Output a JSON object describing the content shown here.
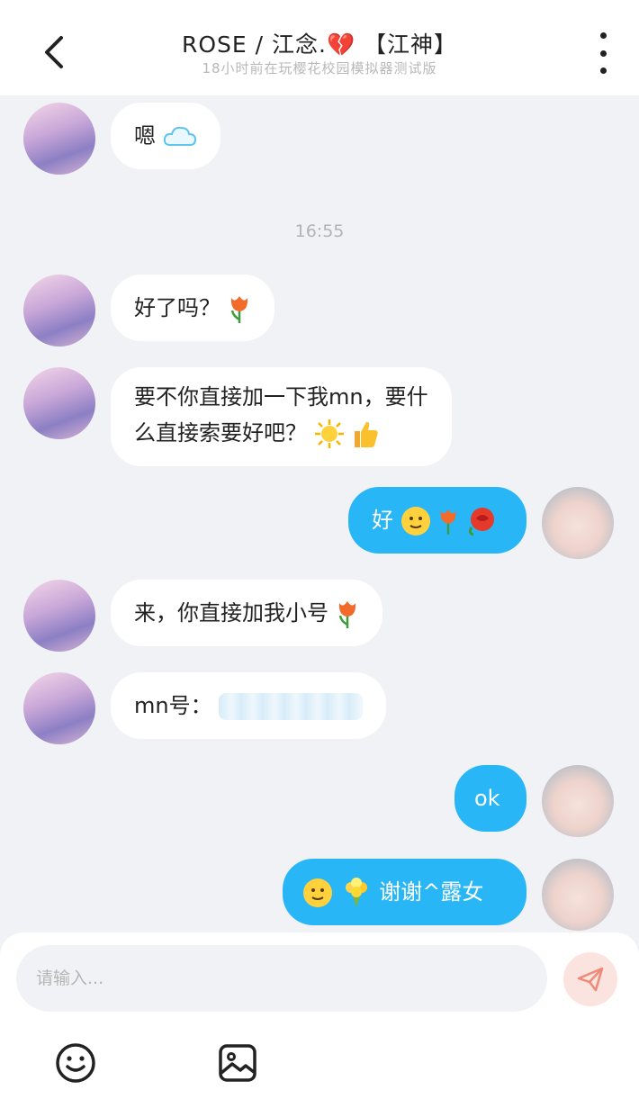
{
  "header": {
    "title": "ROSE / 江念.💔 【江神】",
    "subtitle": "18小时前在玩樱花校园模拟器测试版"
  },
  "chat": {
    "timestamp": "16:55",
    "messages": [
      {
        "side": "left",
        "text": "嗯"
      },
      {
        "side": "left",
        "text": "好了吗？"
      },
      {
        "side": "left",
        "line1": "要不你直接加一下我mn，要什",
        "line2": "么直接索要好吧？"
      },
      {
        "side": "right",
        "text": "好"
      },
      {
        "side": "left",
        "text": "来，你直接加我小号"
      },
      {
        "side": "left",
        "text": "mn号："
      },
      {
        "side": "right",
        "text": "ok"
      },
      {
        "side": "right",
        "text": "谢谢^露女"
      }
    ]
  },
  "composer": {
    "placeholder": "请输入..."
  },
  "colors": {
    "accent": "#29b6f6",
    "send_bg": "#fbe3df",
    "send_icon": "#f08a78"
  },
  "icons": [
    "back-arrow-icon",
    "more-vertical-icon",
    "send-icon",
    "emoji-icon",
    "image-icon",
    "cloud-icon",
    "tulip-icon",
    "sun-icon",
    "thumbs-up-icon",
    "slight-smile-icon",
    "rose-icon",
    "bouquet-icon"
  ]
}
